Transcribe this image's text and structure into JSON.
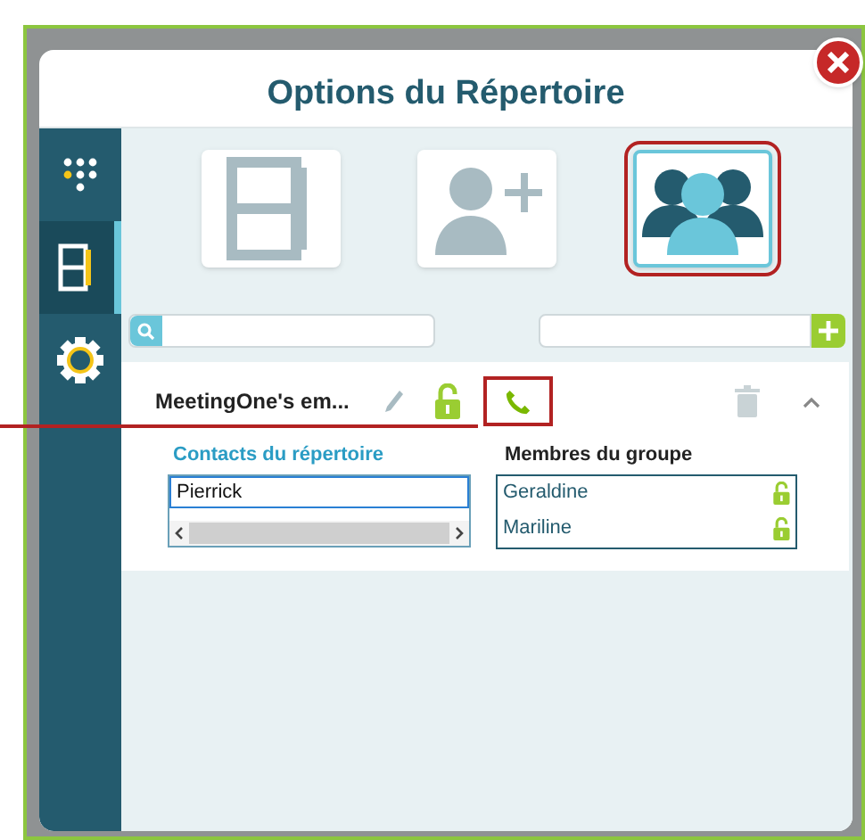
{
  "dialog": {
    "title": "Options du Répertoire"
  },
  "sidebar": {
    "items": [
      {
        "kind": "dialpad",
        "selected": false
      },
      {
        "kind": "directory",
        "selected": true
      },
      {
        "kind": "settings",
        "selected": false
      }
    ]
  },
  "tiles": [
    {
      "kind": "directory",
      "selected": false
    },
    {
      "kind": "add-contact",
      "selected": false
    },
    {
      "kind": "groups",
      "selected": true
    }
  ],
  "group": {
    "name": "MeetingOne's em...",
    "expanded": true,
    "contacts": {
      "heading": "Contacts du répertoire",
      "value": "Pierrick"
    },
    "members": {
      "heading": "Membres du groupe",
      "items": [
        {
          "name": "Geraldine"
        },
        {
          "name": "Mariline"
        }
      ]
    }
  }
}
